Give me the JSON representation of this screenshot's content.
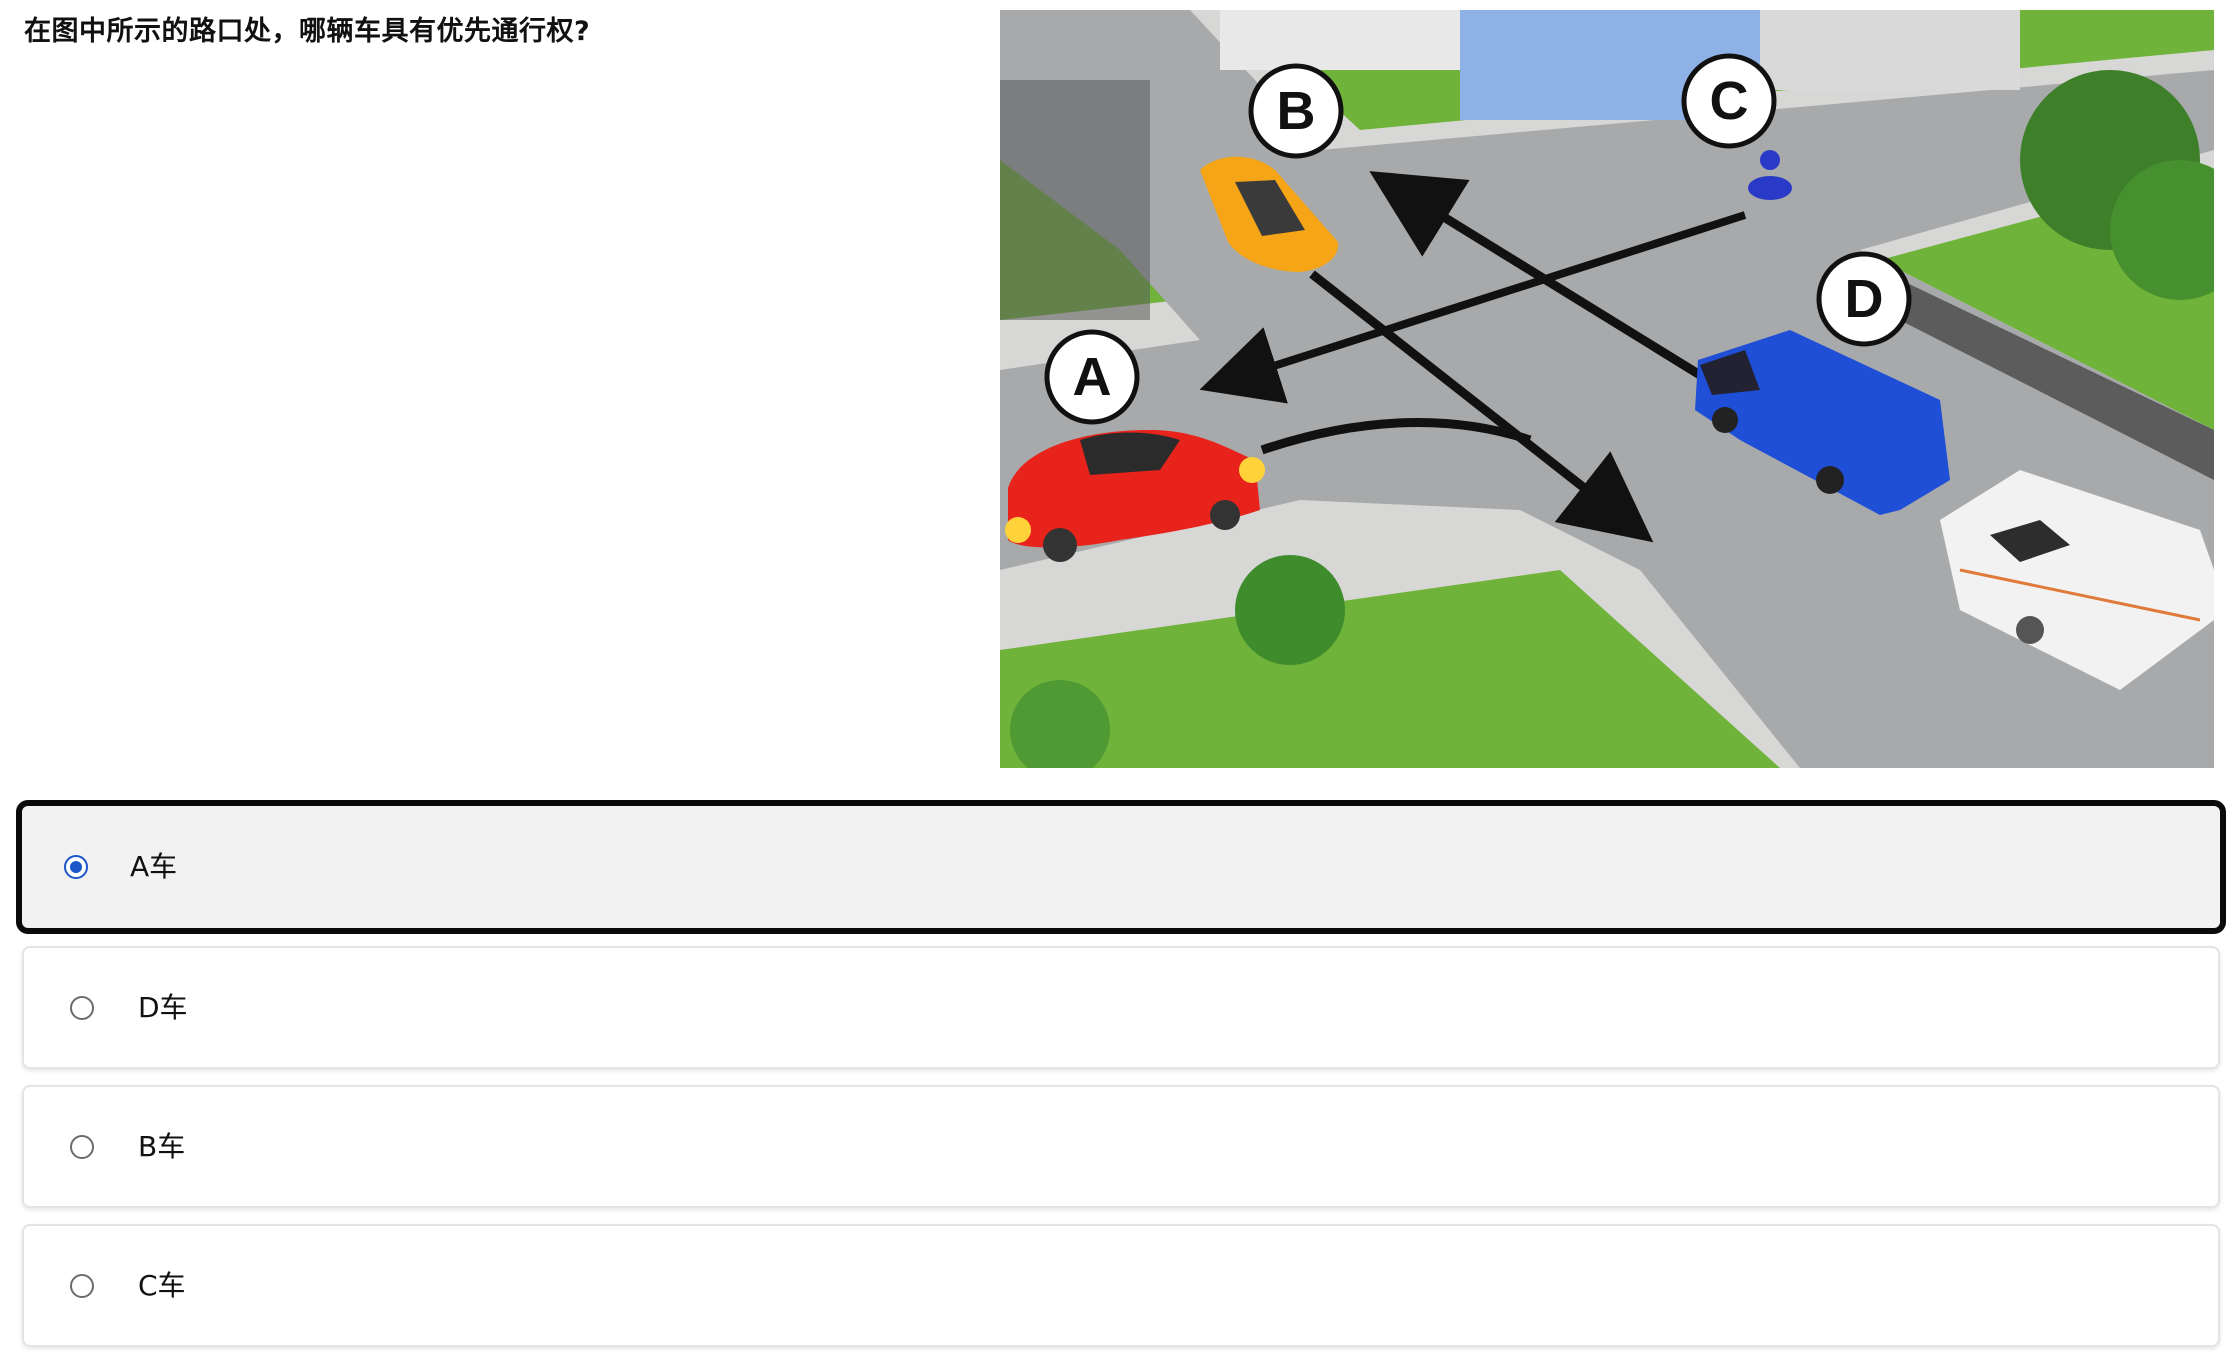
{
  "question": {
    "text": "在图中所示的路口处，哪辆车具有优先通行权?"
  },
  "scene": {
    "labels": [
      "A",
      "B",
      "C",
      "D"
    ]
  },
  "options": [
    {
      "label": "A车",
      "selected": true
    },
    {
      "label": "D车",
      "selected": false
    },
    {
      "label": "B车",
      "selected": false
    },
    {
      "label": "C车",
      "selected": false
    }
  ],
  "colors": {
    "selected_border": "#0a0a0a",
    "selected_background": "#f2f2f2",
    "radio_accent": "#1a56c8",
    "car_a": "#e8231c",
    "car_b": "#f5a516",
    "van_d": "#1f4fd6",
    "motorbike_c": "#2a3ac8",
    "grass": "#6fb33a",
    "road": "#a7a9ab"
  }
}
